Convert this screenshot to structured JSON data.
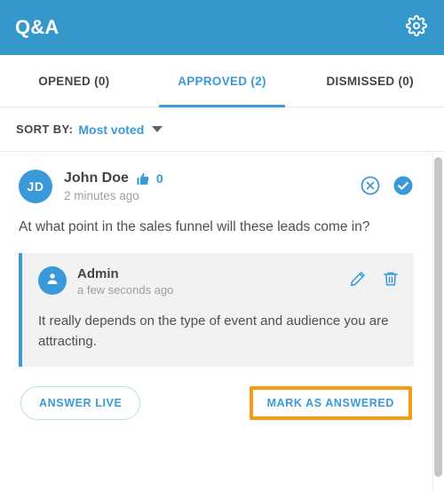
{
  "header": {
    "title": "Q&A",
    "settings_icon": "gear-icon"
  },
  "tabs": [
    {
      "label": "OPENED (0)",
      "name": "opened",
      "active": false
    },
    {
      "label": "APPROVED (2)",
      "name": "approved",
      "active": true
    },
    {
      "label": "DISMISSED (0)",
      "name": "dismissed",
      "active": false
    }
  ],
  "sort": {
    "label": "SORT BY:",
    "value": "Most voted",
    "caret_icon": "chevron-down-icon"
  },
  "question": {
    "avatar_initials": "JD",
    "author": "John Doe",
    "vote_icon": "thumbs-up-icon",
    "vote_count": "0",
    "timestamp": "2 minutes ago",
    "text": "At what point in the sales funnel will these leads come in?",
    "dismiss_icon": "dismiss-circle-icon",
    "approve_icon": "check-circle-icon"
  },
  "answer": {
    "avatar_icon": "person-icon",
    "author": "Admin",
    "timestamp": "a few seconds ago",
    "text": "It really depends on the type of event and audience you are attracting.",
    "edit_icon": "pencil-icon",
    "delete_icon": "trash-icon"
  },
  "footer": {
    "answer_live_label": "ANSWER LIVE",
    "mark_answered_label": "MARK AS ANSWERED"
  },
  "colors": {
    "header_blue": "#3498ca",
    "accent_blue": "#3a9ad9",
    "highlight_orange": "#f59b14",
    "answer_bg": "#f2f2f2",
    "muted_text": "#9aa0a4"
  }
}
